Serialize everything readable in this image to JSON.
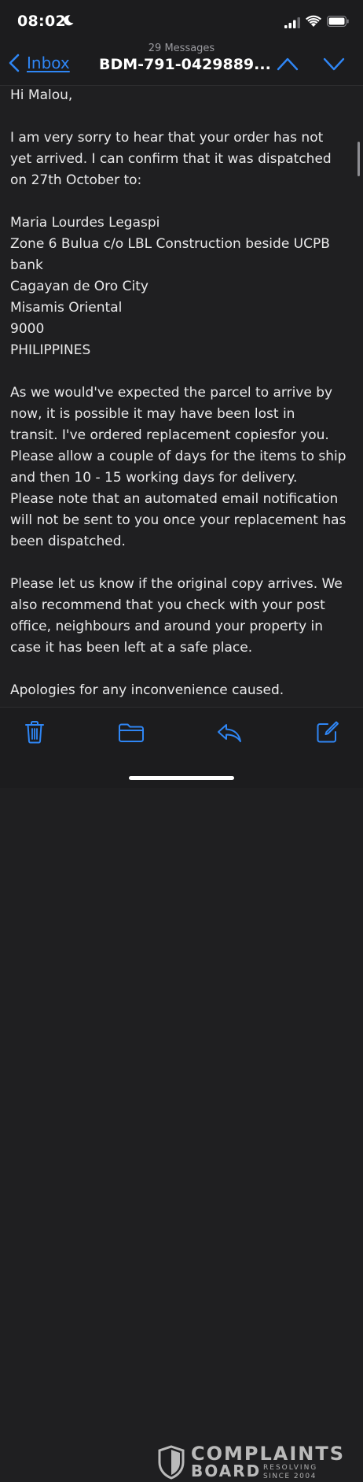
{
  "status_bar": {
    "time": "08:02"
  },
  "header": {
    "back_label": "Inbox",
    "message_count": "29 Messages",
    "subject": "BDM-791-0429889..."
  },
  "email": {
    "lines": [
      "Hi Malou,",
      "",
      "I am very sorry to hear that your order has not",
      "yet arrived. I can confirm that it was dispatched",
      "on 27th October to:",
      "",
      "Maria Lourdes Legaspi",
      "Zone 6 Bulua c/o LBL Construction beside UCPB",
      "bank",
      "Cagayan de Oro City",
      "Misamis Oriental",
      "9000",
      "PHILIPPINES",
      "",
      "As we would've expected the parcel to arrive by",
      "now, it is possible it may have been lost in",
      "transit. I've ordered replacement copiesfor you.",
      "Please allow a couple of days for the items to ship",
      "and then 10 - 15 working days for delivery.",
      "Please note that an automated email notification",
      "will not be sent to you once your replacement has",
      "been dispatched.",
      "",
      "Please let us know if the original copy arrives. We",
      "also recommend that you check with your post",
      "office, neighbours and around your property in",
      "case it has been left at a safe place.",
      "",
      "Apologies for any inconvenience caused."
    ]
  },
  "toolbar": {
    "icons": [
      "trash-icon",
      "folder-icon",
      "reply-icon",
      "compose-icon"
    ]
  },
  "watermark": {
    "line1": "COMPLAINTS",
    "line2": "BOARD",
    "tag1": "RESOLVING",
    "tag2": "SINCE 2004"
  },
  "colors": {
    "accent": "#2f86f5",
    "background": "#1f1f21",
    "text": "#e9e9ea"
  }
}
